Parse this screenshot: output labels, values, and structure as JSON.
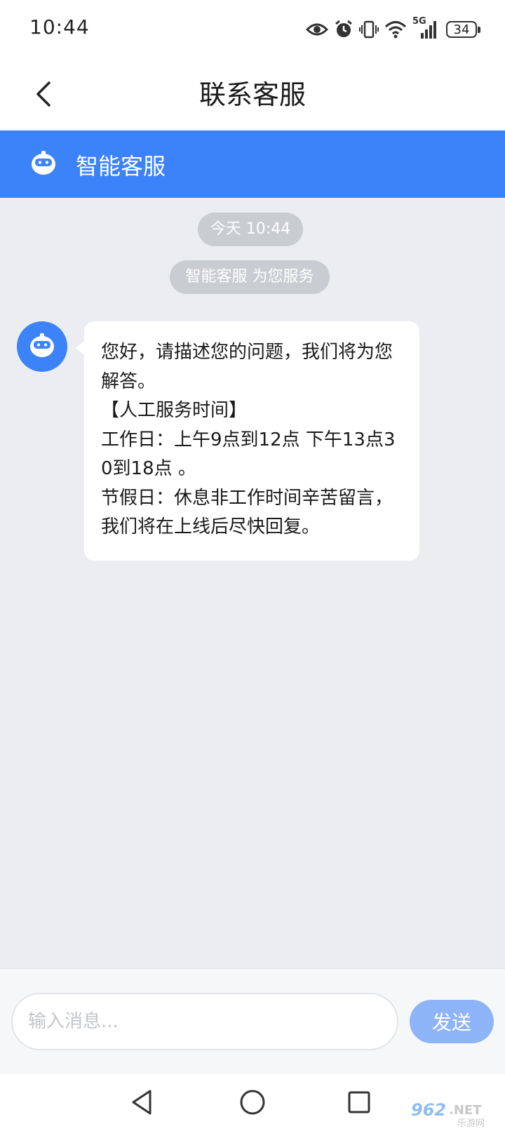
{
  "status_bar": {
    "time": "10:44",
    "network": "5G",
    "battery": "34",
    "icons": [
      "eye-icon",
      "alarm-icon",
      "vibrate-icon",
      "wifi-icon",
      "signal-icon",
      "battery-icon"
    ]
  },
  "header": {
    "title": "联系客服",
    "back_icon": "chevron-left-icon"
  },
  "service_bar": {
    "title": "智能客服",
    "icon": "robot-icon"
  },
  "chat": {
    "timestamp": "今天 10:44",
    "system_notice": "智能客服 为您服务",
    "messages": [
      {
        "sender": "bot",
        "avatar_icon": "robot-icon",
        "lines": [
          "您好，请描述您的问题，我们将为您解答。",
          "【人工服务时间】",
          "工作日：上午9点到12点 下午13点30到18点 。",
          "节假日：休息非工作时间辛苦留言，我们将在上线后尽快回复。"
        ]
      }
    ]
  },
  "input_bar": {
    "placeholder": "输入消息...",
    "value": "",
    "send_label": "发送"
  },
  "system_nav": {
    "buttons": [
      "back-triangle-icon",
      "home-circle-icon",
      "recents-square-icon"
    ]
  },
  "watermark": {
    "text_main": "962.NET",
    "text_sub": "乐游网"
  },
  "colors": {
    "accent": "#3c82f8",
    "chat_background": "#ebedf0",
    "send_button": "#8db4f6",
    "pill": "#c9ccd1"
  }
}
